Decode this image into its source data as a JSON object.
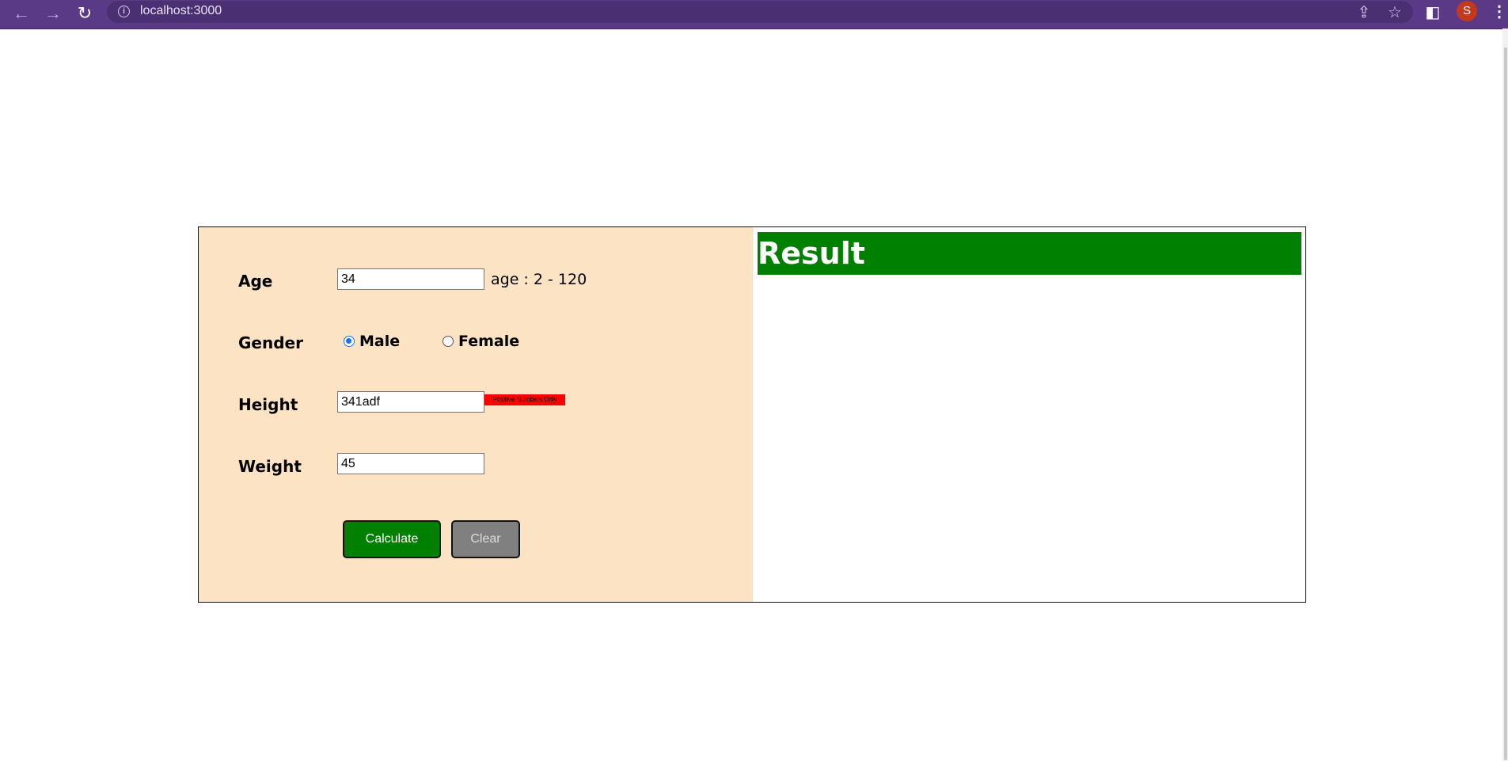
{
  "browser": {
    "url": "localhost:3000",
    "back_icon": "arrow-left-icon",
    "forward_icon": "arrow-right-icon",
    "reload_icon": "reload-icon",
    "share_icon": "share-icon",
    "bookmark_icon": "star-icon",
    "sidepanel_icon": "side-panel-icon",
    "profile_initial": "S",
    "menu_icon": "kebab-icon",
    "colors": {
      "toolbar": "#5a3a86",
      "avatar": "#c4381d"
    }
  },
  "form": {
    "age": {
      "label": "Age",
      "value": "34",
      "hint": "age : 2 - 120"
    },
    "gender": {
      "label": "Gender",
      "options": [
        {
          "label": "Male",
          "checked": true
        },
        {
          "label": "Female",
          "checked": false
        }
      ]
    },
    "height": {
      "label": "Height",
      "value": "341adf",
      "error": "Positive Numbers Only"
    },
    "weight": {
      "label": "Weight",
      "value": "45"
    },
    "buttons": {
      "calculate": "Calculate",
      "clear": "Clear"
    },
    "colors": {
      "panel": "#fce3c4",
      "calculate": "#008000",
      "clear": "#808080",
      "error": "#ff0000"
    }
  },
  "result": {
    "title": "Result",
    "colors": {
      "header": "#008000"
    }
  }
}
